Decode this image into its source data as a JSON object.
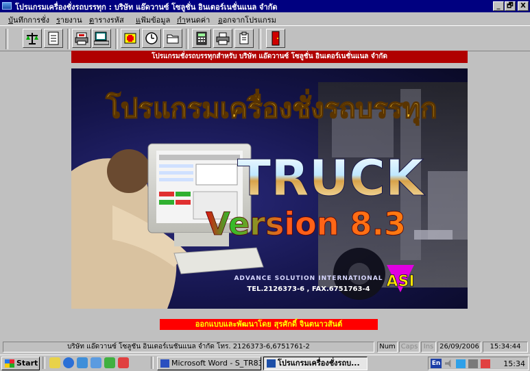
{
  "window": {
    "title": "โปรแกรมเครื่องชั่งรถบรรทุก : บริษัท แอ๊ดวานซ์ โซลูชั่น อินเตอร์เนชั่นแนล จำกัด",
    "controls": [
      "_",
      "🗗",
      "X"
    ]
  },
  "menu": [
    "บันทึกการชั่ง",
    "รายงาน",
    "ตารางรหัส",
    "แฟ้มข้อมูล",
    "กำหนดค่า",
    "ออกจากโปรแกรม"
  ],
  "banner": "โปรแกรมชั่งรถบรรทุกสำหรับ  บริษัท แอ๊ดวานซ์ โซลูชั่น อินเตอร์เนชั่นแนล จำกัด",
  "splash": {
    "thai_title": "โปรแกรมเครื่องชั่งรถบรรทุก",
    "product": "TRUCK",
    "version": "Version 8.3",
    "company": "ADVANCE SOLUTION INTERNATIONAL",
    "contact": "TEL.2126373-6 , FAX.6751763-4",
    "logo": "ASI"
  },
  "credit": "ออกแบบและพัฒนาโดย    สุรศักดิ์ จินตนาวสันต์",
  "status": {
    "company_info": "บริษัท แอ๊ดวานซ์ โซลูชั่น อินเตอร์เนชั่นแนล จำกัด โทร. 2126373-6,6751761-2",
    "num": "Num",
    "caps": "Caps",
    "ins": "Ins",
    "date": "26/09/2006",
    "time": "15:34:44"
  },
  "taskbar": {
    "start": "Start",
    "tasks": [
      "Microsoft Word - S_TR83",
      "โปรแกรมเครื่องชั่งรถบ..."
    ],
    "lang": "En",
    "clock": "15:34"
  },
  "colors": {
    "banner_bg": "#b00000",
    "credit_bg": "#ff0000",
    "credit_text": "#ffff00",
    "title_bg": "#000080"
  }
}
